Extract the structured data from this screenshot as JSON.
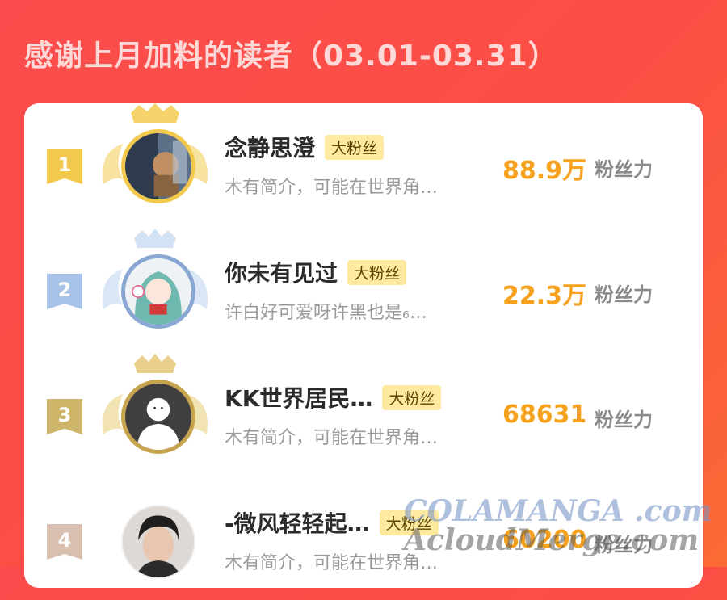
{
  "header": {
    "title": "感谢上月加料的读者（03.01-03.31）"
  },
  "colors": {
    "background": "#fb4d4d",
    "accent_score": "#f6a21e",
    "tag_bg": "#fde9a0",
    "rank1": "#f2c94c",
    "rank2": "#a9c3e8",
    "rank3": "#cdb66a",
    "rank4": "#d8bfb0"
  },
  "readers": [
    {
      "rank": "1",
      "name": "念静思澄",
      "tag": "大粉丝",
      "bio": "木有简介，可能在世界角…",
      "score": "88.9万",
      "unit": "粉丝力",
      "avatar_icon": "photo-avatar-icon"
    },
    {
      "rank": "2",
      "name": "你未有见过",
      "tag": "大粉丝",
      "bio": "许白好可爱呀许黑也是₆…",
      "score": "22.3万",
      "unit": "粉丝力",
      "avatar_icon": "anime-avatar-icon"
    },
    {
      "rank": "3",
      "name": "KK世界居民…",
      "tag": "大粉丝",
      "bio": "木有简介，可能在世界角…",
      "score": "68631",
      "unit": "粉丝力",
      "avatar_icon": "default-user-icon"
    },
    {
      "rank": "4",
      "name": "-微风轻轻起…",
      "tag": "大粉丝",
      "bio": "木有简介，可能在世界角…",
      "score": "60200",
      "unit": "粉丝力",
      "avatar_icon": "portrait-avatar-icon"
    }
  ],
  "watermark": {
    "line1": "COLAMANGA .com",
    "line2": "AcloudMerge.com"
  }
}
